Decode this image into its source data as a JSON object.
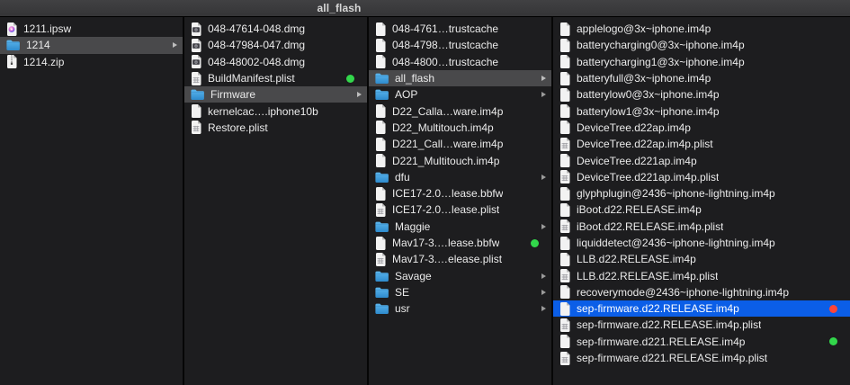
{
  "window": {
    "title": "all_flash"
  },
  "colors": {
    "selection_blue": "#0b5ee7",
    "selection_gray": "#49494b",
    "tag_green": "#32d74b",
    "tag_red": "#ff453a",
    "folder_blue": "#3fa0e2",
    "background": "#1d1d1f"
  },
  "columns": [
    {
      "name": "column-1",
      "items": [
        {
          "label": "1211.ipsw",
          "icon": "ipsw-doc"
        },
        {
          "label": "1214",
          "icon": "folder",
          "selected": "gray",
          "expandable": true
        },
        {
          "label": "1214.zip",
          "icon": "zip-doc"
        }
      ]
    },
    {
      "name": "column-2",
      "items": [
        {
          "label": "048-47614-048.dmg",
          "icon": "dmg-doc"
        },
        {
          "label": "048-47984-047.dmg",
          "icon": "dmg-doc"
        },
        {
          "label": "048-48002-048.dmg",
          "icon": "dmg-doc"
        },
        {
          "label": "BuildManifest.plist",
          "icon": "plist-doc",
          "tag": "green"
        },
        {
          "label": "Firmware",
          "icon": "folder",
          "selected": "gray",
          "expandable": true
        },
        {
          "label": "kernelcac….iphone10b",
          "icon": "generic-doc"
        },
        {
          "label": "Restore.plist",
          "icon": "plist-doc"
        }
      ]
    },
    {
      "name": "column-3",
      "items": [
        {
          "label": "048-4761…trustcache",
          "icon": "generic-doc"
        },
        {
          "label": "048-4798…trustcache",
          "icon": "generic-doc"
        },
        {
          "label": "048-4800…trustcache",
          "icon": "generic-doc"
        },
        {
          "label": "all_flash",
          "icon": "folder",
          "selected": "gray",
          "expandable": true
        },
        {
          "label": "AOP",
          "icon": "folder",
          "expandable": true
        },
        {
          "label": "D22_Calla…ware.im4p",
          "icon": "generic-doc"
        },
        {
          "label": "D22_Multitouch.im4p",
          "icon": "generic-doc"
        },
        {
          "label": "D221_Call…ware.im4p",
          "icon": "generic-doc"
        },
        {
          "label": "D221_Multitouch.im4p",
          "icon": "generic-doc"
        },
        {
          "label": "dfu",
          "icon": "folder",
          "expandable": true
        },
        {
          "label": "ICE17-2.0…lease.bbfw",
          "icon": "generic-doc"
        },
        {
          "label": "ICE17-2.0…lease.plist",
          "icon": "plist-doc"
        },
        {
          "label": "Maggie",
          "icon": "folder",
          "expandable": true
        },
        {
          "label": "Mav17-3.…lease.bbfw",
          "icon": "generic-doc",
          "tag": "green"
        },
        {
          "label": "Mav17-3.…elease.plist",
          "icon": "plist-doc"
        },
        {
          "label": "Savage",
          "icon": "folder",
          "expandable": true
        },
        {
          "label": "SE",
          "icon": "folder",
          "expandable": true
        },
        {
          "label": "usr",
          "icon": "folder",
          "expandable": true
        }
      ]
    },
    {
      "name": "column-4",
      "items": [
        {
          "label": "applelogo@3x~iphone.im4p",
          "icon": "generic-doc"
        },
        {
          "label": "batterycharging0@3x~iphone.im4p",
          "icon": "generic-doc"
        },
        {
          "label": "batterycharging1@3x~iphone.im4p",
          "icon": "generic-doc"
        },
        {
          "label": "batteryfull@3x~iphone.im4p",
          "icon": "generic-doc"
        },
        {
          "label": "batterylow0@3x~iphone.im4p",
          "icon": "generic-doc"
        },
        {
          "label": "batterylow1@3x~iphone.im4p",
          "icon": "generic-doc"
        },
        {
          "label": "DeviceTree.d22ap.im4p",
          "icon": "generic-doc"
        },
        {
          "label": "DeviceTree.d22ap.im4p.plist",
          "icon": "plist-doc"
        },
        {
          "label": "DeviceTree.d221ap.im4p",
          "icon": "generic-doc"
        },
        {
          "label": "DeviceTree.d221ap.im4p.plist",
          "icon": "plist-doc"
        },
        {
          "label": "glyphplugin@2436~iphone-lightning.im4p",
          "icon": "generic-doc"
        },
        {
          "label": "iBoot.d22.RELEASE.im4p",
          "icon": "generic-doc"
        },
        {
          "label": "iBoot.d22.RELEASE.im4p.plist",
          "icon": "plist-doc"
        },
        {
          "label": "liquiddetect@2436~iphone-lightning.im4p",
          "icon": "generic-doc"
        },
        {
          "label": "LLB.d22.RELEASE.im4p",
          "icon": "generic-doc"
        },
        {
          "label": "LLB.d22.RELEASE.im4p.plist",
          "icon": "plist-doc"
        },
        {
          "label": "recoverymode@2436~iphone-lightning.im4p",
          "icon": "generic-doc"
        },
        {
          "label": "sep-firmware.d22.RELEASE.im4p",
          "icon": "generic-doc",
          "selected": "blue",
          "tag": "red"
        },
        {
          "label": "sep-firmware.d22.RELEASE.im4p.plist",
          "icon": "plist-doc"
        },
        {
          "label": "sep-firmware.d221.RELEASE.im4p",
          "icon": "generic-doc",
          "tag": "green"
        },
        {
          "label": "sep-firmware.d221.RELEASE.im4p.plist",
          "icon": "plist-doc"
        }
      ]
    }
  ]
}
